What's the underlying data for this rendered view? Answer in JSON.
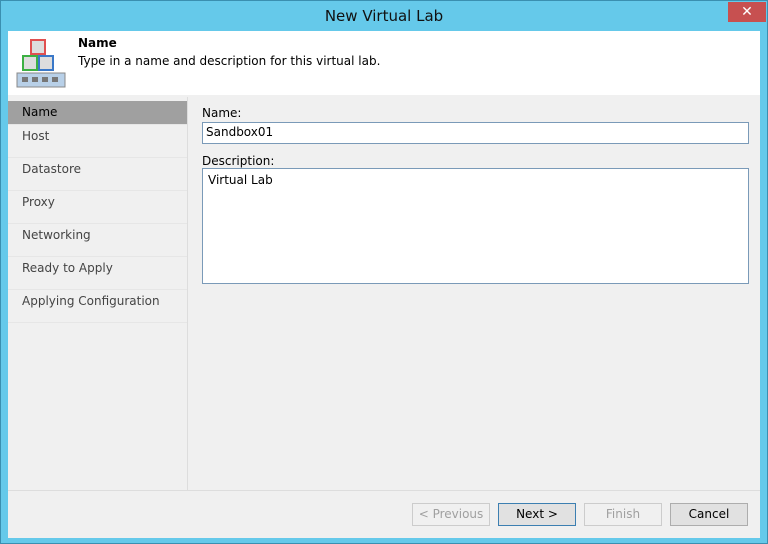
{
  "window": {
    "title": "New Virtual Lab",
    "close": "✕"
  },
  "header": {
    "title": "Name",
    "description": "Type in a name and description for this virtual lab."
  },
  "steps": [
    "Name",
    "Host",
    "Datastore",
    "Proxy",
    "Networking",
    "Ready to Apply",
    "Applying Configuration"
  ],
  "form": {
    "name_label": "Name:",
    "name_value": "Sandbox01",
    "description_label": "Description:",
    "description_value": "Virtual Lab"
  },
  "buttons": {
    "previous": "< Previous",
    "next": "Next >",
    "finish": "Finish",
    "cancel": "Cancel"
  }
}
